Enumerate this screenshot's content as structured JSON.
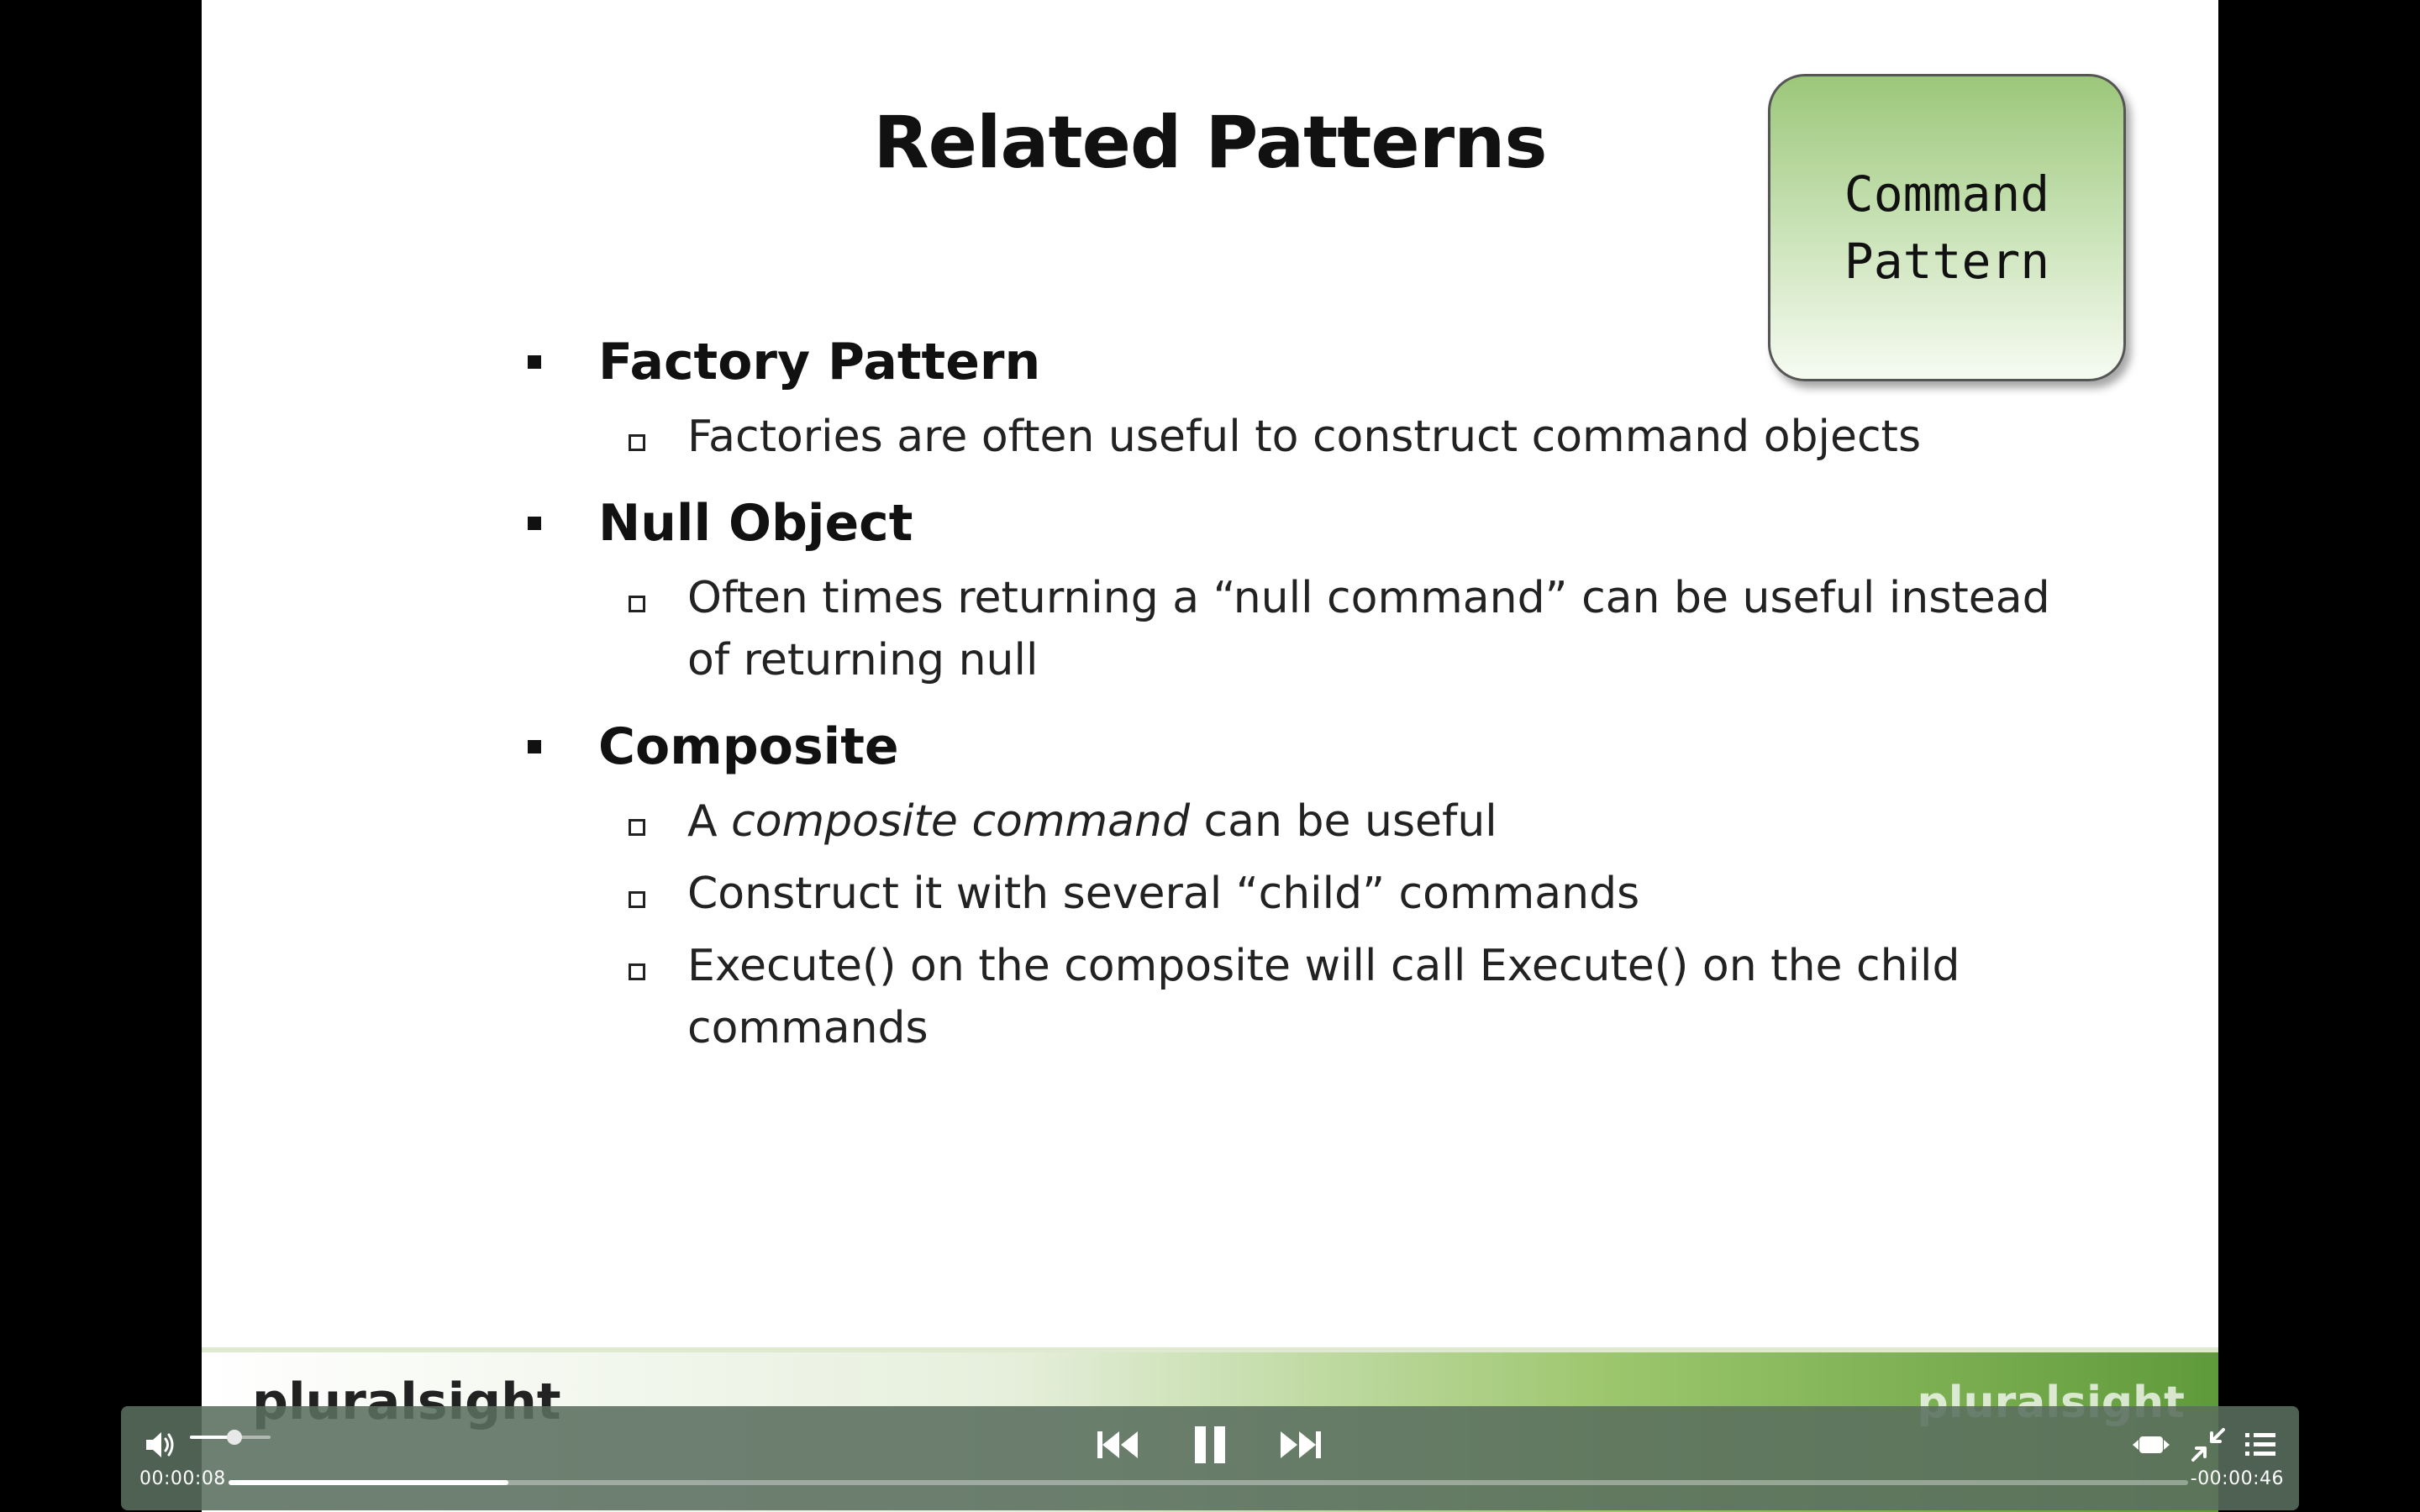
{
  "slide": {
    "title": "Related Patterns",
    "badge": {
      "line1": "Command",
      "line2": "Pattern"
    },
    "bullets": [
      {
        "heading": "Factory Pattern",
        "sub": [
          "Factories are often useful to construct command objects"
        ]
      },
      {
        "heading": "Null Object",
        "sub": [
          "Often times returning a “null command” can be useful instead of returning null"
        ]
      },
      {
        "heading": "Composite",
        "sub_composite": {
          "prefix": "A ",
          "italic": "composite command",
          "suffix": " can be useful"
        },
        "sub": [
          "Construct it with several “child” commands",
          "Execute() on the composite will call Execute() on the child commands"
        ]
      }
    ],
    "footer": {
      "brand_left": "pluralsight",
      "brand_right": "pluralsight"
    }
  },
  "player": {
    "time_elapsed": "00:00:08",
    "time_remaining": "-00:00:46",
    "progress": 0.143,
    "volume": 0.55,
    "icons": {
      "volume": "speaker-icon",
      "previous": "skip-back-icon",
      "pause": "pause-icon",
      "next": "skip-forward-icon",
      "aspect": "aspect-ratio-icon",
      "exit_fullscreen": "exit-fullscreen-icon",
      "chapters": "chapter-list-icon"
    }
  }
}
